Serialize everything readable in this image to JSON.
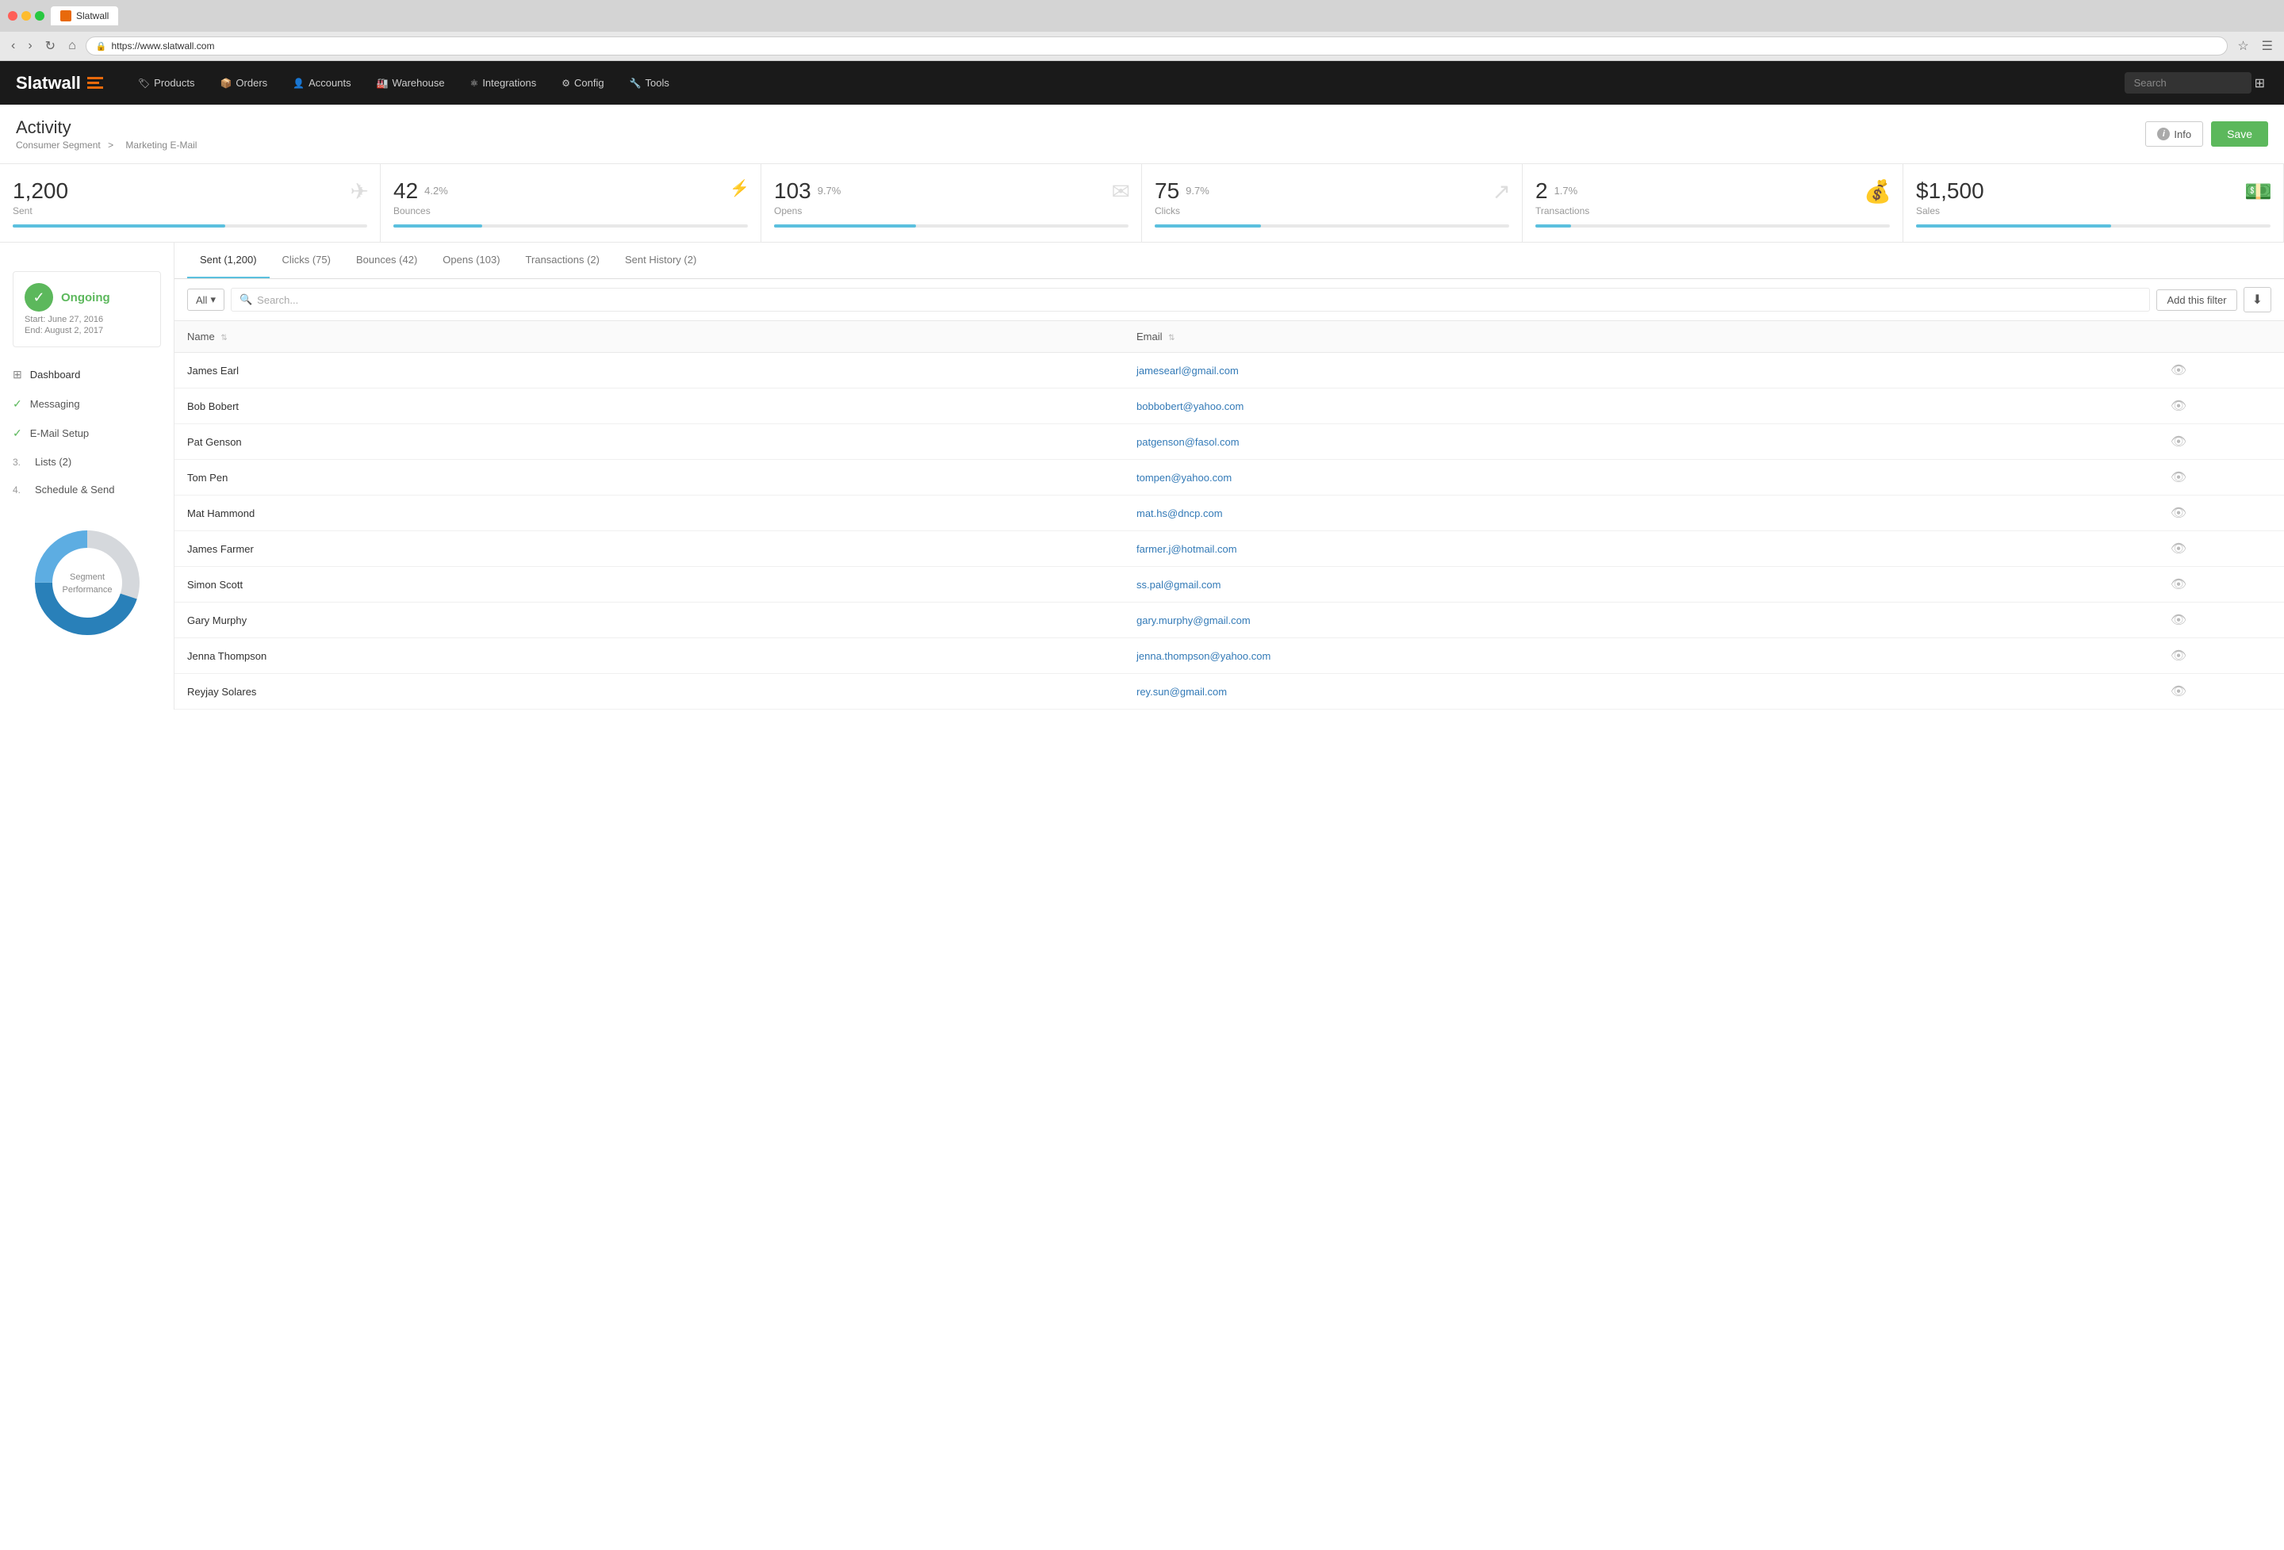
{
  "browser": {
    "url": "https://www.slatwall.com",
    "tab_title": "Slatwall"
  },
  "header": {
    "logo": "Slatwall",
    "nav_items": [
      {
        "label": "Products",
        "icon": "🏷"
      },
      {
        "label": "Orders",
        "icon": "📦"
      },
      {
        "label": "Accounts",
        "icon": "👤"
      },
      {
        "label": "Warehouse",
        "icon": "🏭"
      },
      {
        "label": "Integrations",
        "icon": "⚛"
      },
      {
        "label": "Config",
        "icon": "⚙"
      },
      {
        "label": "Tools",
        "icon": "🔧"
      }
    ],
    "search_placeholder": "Search",
    "info_label": "Info",
    "save_label": "Save"
  },
  "page": {
    "title": "Activity",
    "breadcrumb_parent": "Consumer Segment",
    "breadcrumb_separator": ">",
    "breadcrumb_current": "Marketing E-Mail"
  },
  "status": {
    "label": "Ongoing",
    "start": "Start: June 27, 2016",
    "end": "End: August 2, 2017"
  },
  "stats": [
    {
      "value": "1,200",
      "percent": "",
      "label": "Sent",
      "bar_width": "60",
      "icon": "✈"
    },
    {
      "value": "42",
      "percent": "4.2%",
      "label": "Bounces",
      "bar_width": "25",
      "icon": "Y"
    },
    {
      "value": "103",
      "percent": "9.7%",
      "label": "Opens",
      "bar_width": "40",
      "icon": "✉"
    },
    {
      "value": "75",
      "percent": "9.7%",
      "label": "Clicks",
      "bar_width": "30",
      "icon": "↗"
    },
    {
      "value": "2",
      "percent": "1.7%",
      "label": "Transactions",
      "bar_width": "10",
      "icon": "💰"
    },
    {
      "value": "$1,500",
      "percent": "",
      "label": "Sales",
      "bar_width": "55",
      "icon": "💵"
    }
  ],
  "sidebar": {
    "items": [
      {
        "type": "check",
        "label": "Dashboard",
        "icon": "dashboard"
      },
      {
        "type": "check",
        "label": "Messaging"
      },
      {
        "type": "check",
        "label": "E-Mail Setup"
      },
      {
        "type": "num",
        "num": "3.",
        "label": "Lists (2)"
      },
      {
        "type": "num",
        "num": "4.",
        "label": "Schedule & Send"
      }
    ],
    "segment_performance": "Segment Performance"
  },
  "tabs": [
    {
      "label": "Sent (1,200)",
      "active": true
    },
    {
      "label": "Clicks (75)",
      "active": false
    },
    {
      "label": "Bounces (42)",
      "active": false
    },
    {
      "label": "Opens (103)",
      "active": false
    },
    {
      "label": "Transactions (2)",
      "active": false
    },
    {
      "label": "Sent History (2)",
      "active": false
    }
  ],
  "filter": {
    "dropdown_label": "All",
    "search_placeholder": "Search...",
    "add_filter_label": "Add this filter"
  },
  "table": {
    "columns": [
      {
        "label": "Name"
      },
      {
        "label": "Email"
      },
      {
        "label": ""
      }
    ],
    "rows": [
      {
        "name": "James Earl",
        "email": "jamesearl@gmail.com"
      },
      {
        "name": "Bob Bobert",
        "email": "bobbobert@yahoo.com"
      },
      {
        "name": "Pat Genson",
        "email": "patgenson@fasol.com"
      },
      {
        "name": "Tom Pen",
        "email": "tompen@yahoo.com"
      },
      {
        "name": "Mat Hammond",
        "email": "mat.hs@dncp.com"
      },
      {
        "name": "James Farmer",
        "email": "farmer.j@hotmail.com"
      },
      {
        "name": "Simon Scott",
        "email": "ss.pal@gmail.com"
      },
      {
        "name": "Gary Murphy",
        "email": "gary.murphy@gmail.com"
      },
      {
        "name": "Jenna Thompson",
        "email": "jenna.thompson@yahoo.com"
      },
      {
        "name": "Reyjay Solares",
        "email": "rey.sun@gmail.com"
      }
    ]
  },
  "donut": {
    "segments": [
      {
        "color": "#2980b9",
        "value": 45
      },
      {
        "color": "#5dade2",
        "value": 25
      },
      {
        "color": "#d5d8dc",
        "value": 30
      }
    ],
    "label": "Segment Performance"
  }
}
